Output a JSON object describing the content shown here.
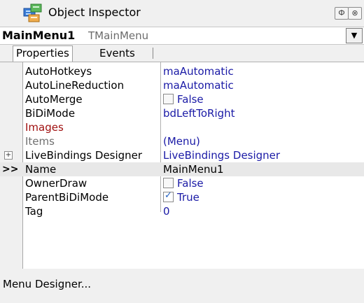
{
  "window": {
    "title": "Object Inspector",
    "pin_glyph": "Ф",
    "close_glyph": "⊗"
  },
  "component": {
    "name": "MainMenu1",
    "type": "TMainMenu",
    "dropdown_glyph": "▼"
  },
  "tabs": [
    {
      "label": "Properties",
      "active": true
    },
    {
      "label": "Events",
      "active": false
    }
  ],
  "properties": [
    {
      "name": "AutoHotkeys",
      "value": "maAutomatic"
    },
    {
      "name": "AutoLineReduction",
      "value": "maAutomatic"
    },
    {
      "name": "AutoMerge",
      "value": "False",
      "checkbox": false
    },
    {
      "name": "BiDiMode",
      "value": "bdLeftToRight"
    },
    {
      "name": "Images",
      "value": "",
      "style": "red"
    },
    {
      "name": "Items",
      "value": "(Menu)",
      "style": "gray"
    },
    {
      "name": "LiveBindings Designer",
      "value": "LiveBindings Designer",
      "expandable": true,
      "expander_glyph": "+"
    },
    {
      "name": "Name",
      "value": "MainMenu1",
      "selected": true,
      "marker": ">>"
    },
    {
      "name": "OwnerDraw",
      "value": "False",
      "checkbox": false
    },
    {
      "name": "ParentBiDiMode",
      "value": "True",
      "checkbox": true,
      "check_glyph": "✓"
    },
    {
      "name": "Tag",
      "value": "0"
    }
  ],
  "status": {
    "link": "Menu Designer..."
  },
  "colors": {
    "value_text": "#1a1aa6",
    "event_red": "#a01010",
    "readonly_gray": "#707070"
  }
}
